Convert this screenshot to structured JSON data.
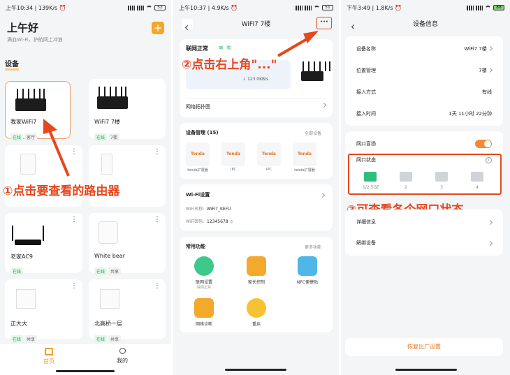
{
  "screen1": {
    "status": {
      "time": "上午10:34",
      "speed": "139K/s",
      "battery": "52"
    },
    "greeting": "上午好",
    "subtitle": "满血Wi-Fi，护航网上冲浪",
    "section_title": "设备",
    "devices": [
      {
        "name": "我家WiFi7",
        "tags": [
          "在线",
          "客厅"
        ]
      },
      {
        "name": "WiFi7  7楼",
        "tags": [
          "在线",
          "7楼"
        ]
      },
      {
        "name": "",
        "tags": []
      },
      {
        "name": "",
        "tags": []
      },
      {
        "name": "老家AC9",
        "tags": [
          "在线"
        ]
      },
      {
        "name": "White bear",
        "tags": [
          "在线",
          "共享"
        ]
      },
      {
        "name": "正大大",
        "tags": [
          "在线",
          "共享"
        ]
      },
      {
        "name": "北高桥一层",
        "tags": [
          "在线",
          "共享"
        ]
      }
    ],
    "nav": {
      "home": "首页",
      "mine": "我的"
    },
    "annotation": "①点击要查看的路由器"
  },
  "screen2": {
    "status": {
      "time": "上午10:37",
      "speed": "4.9K/s",
      "battery": "51"
    },
    "title": "WiFi7  7楼",
    "more": "···",
    "net_status": "联网正常",
    "net_quality": "优",
    "down_speed": "123.0KB/s",
    "topology": "网络拓扑图",
    "device_mgmt": "设备管理 (15)",
    "all_devices": "全部设备",
    "devices": [
      {
        "brand": "Tenda",
        "label": "tenda扩展器"
      },
      {
        "brand": "Tenda",
        "label": "IPC"
      },
      {
        "brand": "Tenda",
        "label": "IPC"
      },
      {
        "brand": "Tenda",
        "label": "tenda扩展器"
      }
    ],
    "wifi_settings": "Wi-Fi设置",
    "wifi_name_label": "WiFi名称:",
    "wifi_name": "WiFi7_KEFU",
    "wifi_pwd_label": "WiFi密码:",
    "wifi_pwd": "12345678",
    "common_title": "常用功能",
    "more_funcs": "更多功能",
    "funcs": [
      {
        "label": "联网设置",
        "sub": "联网正常",
        "color": "#3cc98a"
      },
      {
        "label": "家长控制",
        "sub": "",
        "color": "#f3a92b"
      },
      {
        "label": "NFC便捷贴",
        "sub": "",
        "color": "#4fb7e8"
      },
      {
        "label": "网络诊断",
        "sub": "",
        "color": "#f3a92b"
      },
      {
        "label": "重启",
        "sub": "",
        "color": "#f6c332"
      }
    ],
    "annotation": "②点击右上角\"...\""
  },
  "screen3": {
    "status": {
      "time": "下午3:49",
      "speed": "1.8K/s",
      "battery": "88"
    },
    "title": "设备信息",
    "info": [
      {
        "label": "设备名称",
        "value": "WiFi7  7楼",
        "arrow": true
      },
      {
        "label": "位置管理",
        "value": "7楼",
        "arrow": true
      },
      {
        "label": "接入方式",
        "value": "有线",
        "arrow": false
      },
      {
        "label": "接入时间",
        "value": "1天 11小时 22分钟",
        "arrow": false
      }
    ],
    "port_light": "网口盲扬",
    "port_status": "网口状态",
    "ports": [
      "1/2.5GE",
      "2",
      "3",
      "4"
    ],
    "details": "详细信息",
    "unbind": "解绑设备",
    "reset": "恢复出厂设置",
    "annotation": "③可查看各个网口状态"
  }
}
